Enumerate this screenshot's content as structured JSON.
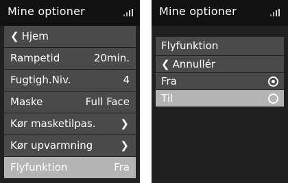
{
  "left_screen": {
    "title": "Mine optioner",
    "items": [
      {
        "label": "Hjem",
        "value": "",
        "type": "back"
      },
      {
        "label": "Rampetid",
        "value": "20min.",
        "type": "value"
      },
      {
        "label": "Fugtigh.Niv.",
        "value": "4",
        "type": "value"
      },
      {
        "label": "Maske",
        "value": "Full Face",
        "type": "value"
      },
      {
        "label": "Kør masketilpas.",
        "value": "",
        "type": "submenu"
      },
      {
        "label": "Kør upvarmning",
        "value": "",
        "type": "submenu"
      },
      {
        "label": "Flyfunktion",
        "value": "Fra",
        "type": "value",
        "selected": true
      }
    ]
  },
  "right_screen": {
    "title": "Mine optioner",
    "dialog": {
      "header": "Flyfunktion",
      "cancel_label": "Annullér",
      "options": [
        {
          "label": "Fra",
          "checked": true
        },
        {
          "label": "Til",
          "checked": false,
          "selected": true
        }
      ]
    }
  },
  "colors": {
    "screen_bg": "#202020",
    "titlebar_bg": "#111111",
    "row_bg": "#4a4a4a",
    "row_selected_bg": "#b4b4b4",
    "text": "#ffffff"
  },
  "icons": {
    "back": "chevron-left-icon",
    "submenu": "chevron-right-icon",
    "signal": "signal-strength-icon",
    "radio_on": "radio-selected-icon",
    "radio_off": "radio-unselected-icon"
  }
}
